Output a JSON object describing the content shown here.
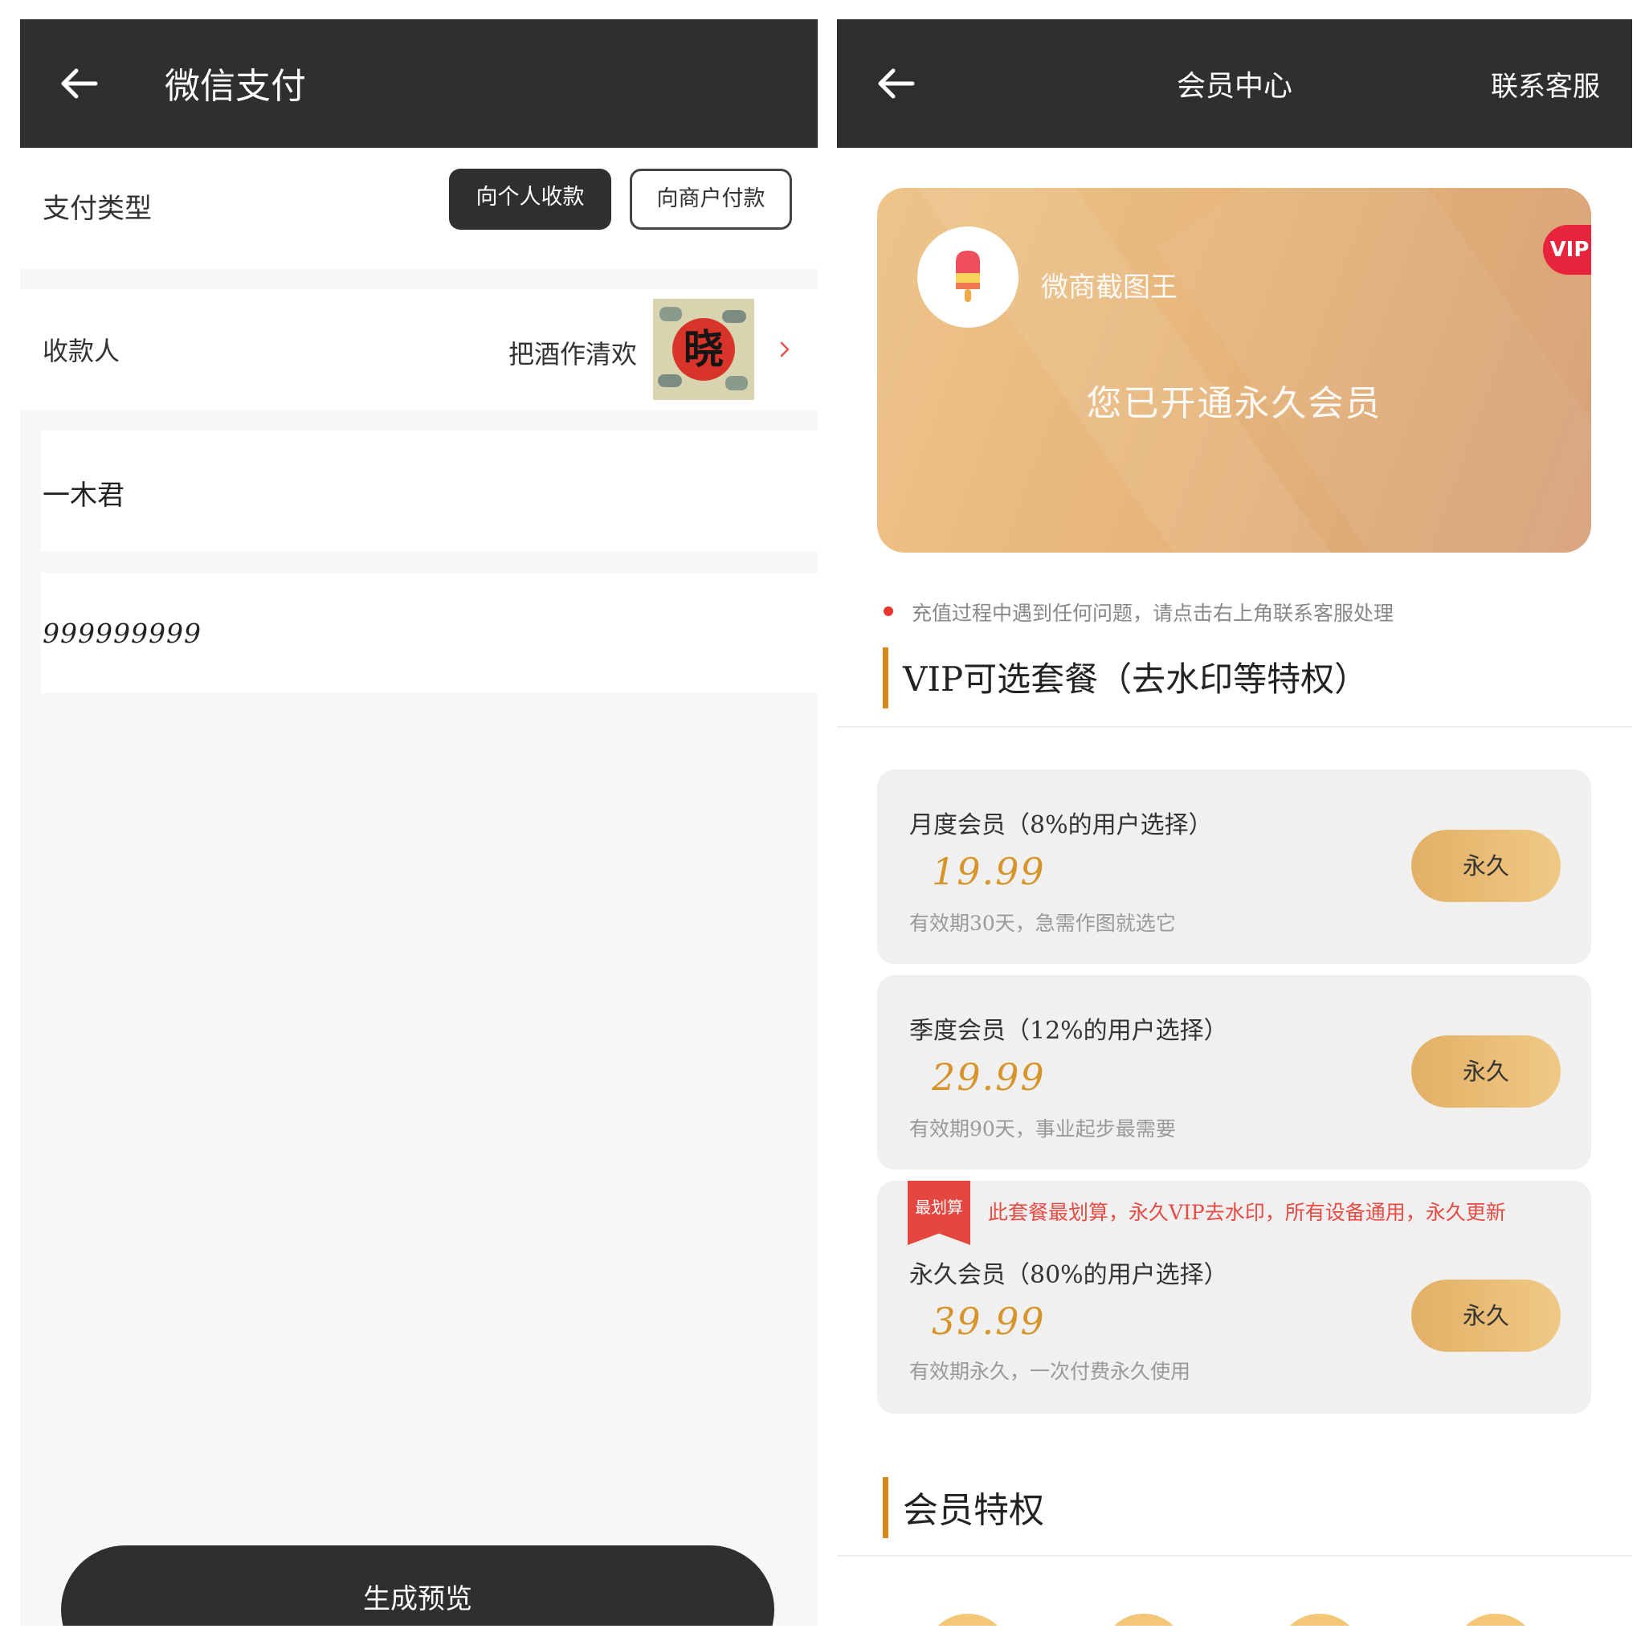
{
  "left": {
    "header": {
      "title": "微信支付"
    },
    "payment_type": {
      "label": "支付类型",
      "options": [
        "向个人收款",
        "向商户付款"
      ],
      "selected": "向个人收款"
    },
    "payee": {
      "label": "收款人",
      "name": "把酒作清欢",
      "avatar_char": "晓"
    },
    "fields": {
      "name_value": "一木君",
      "amount_value": "999999999"
    },
    "generate_button": "生成预览"
  },
  "right": {
    "header": {
      "title": "会员中心",
      "contact": "联系客服"
    },
    "vip_card": {
      "badge": "VIP",
      "username": "微商截图王",
      "status": "您已开通永久会员"
    },
    "notice": "充值过程中遇到任何问题，请点击右上角联系客服处理",
    "plans_section_title": "VIP可选套餐（去水印等特权）",
    "plans": [
      {
        "name": "月度会员（8%的用户选择）",
        "price": "19.99",
        "desc": "有效期30天，急需作图就选它",
        "button": "永久"
      },
      {
        "name": "季度会员（12%的用户选择）",
        "price": "29.99",
        "desc": "有效期90天，事业起步最需要",
        "button": "永久"
      },
      {
        "ribbon": "最划算",
        "promo": "此套餐最划算，永久VIP去水印，所有设备通用，永久更新",
        "name": "永久会员（80%的用户选择）",
        "price": "39.99",
        "desc": "有效期永久，一次付费永久使用",
        "button": "永久"
      }
    ],
    "perks_section_title": "会员特权"
  },
  "colors": {
    "header_bg": "#2f2f2f",
    "gold_accent": "#d48a1e",
    "price": "#d6942a",
    "promo_red": "#e84b43",
    "vip_badge": "#e8243c"
  }
}
